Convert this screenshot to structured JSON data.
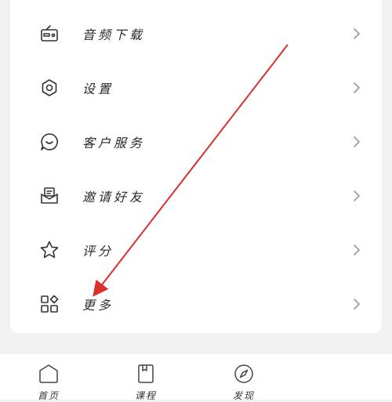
{
  "menu": {
    "items": [
      {
        "label": "音频下载",
        "icon": "radio-icon"
      },
      {
        "label": "设置",
        "icon": "gear-icon"
      },
      {
        "label": "客户服务",
        "icon": "chat-smile-icon"
      },
      {
        "label": "邀请好友",
        "icon": "envelope-icon"
      },
      {
        "label": "评分",
        "icon": "star-icon"
      },
      {
        "label": "更多",
        "icon": "apps-grid-icon"
      }
    ]
  },
  "tabbar": {
    "items": [
      {
        "label": "首页",
        "icon": "home-icon"
      },
      {
        "label": "课程",
        "icon": "book-icon"
      },
      {
        "label": "发现",
        "icon": "compass-icon"
      }
    ]
  },
  "colors": {
    "annotation_arrow": "#d9302c",
    "background": "#f2f2f2",
    "card": "#ffffff"
  }
}
